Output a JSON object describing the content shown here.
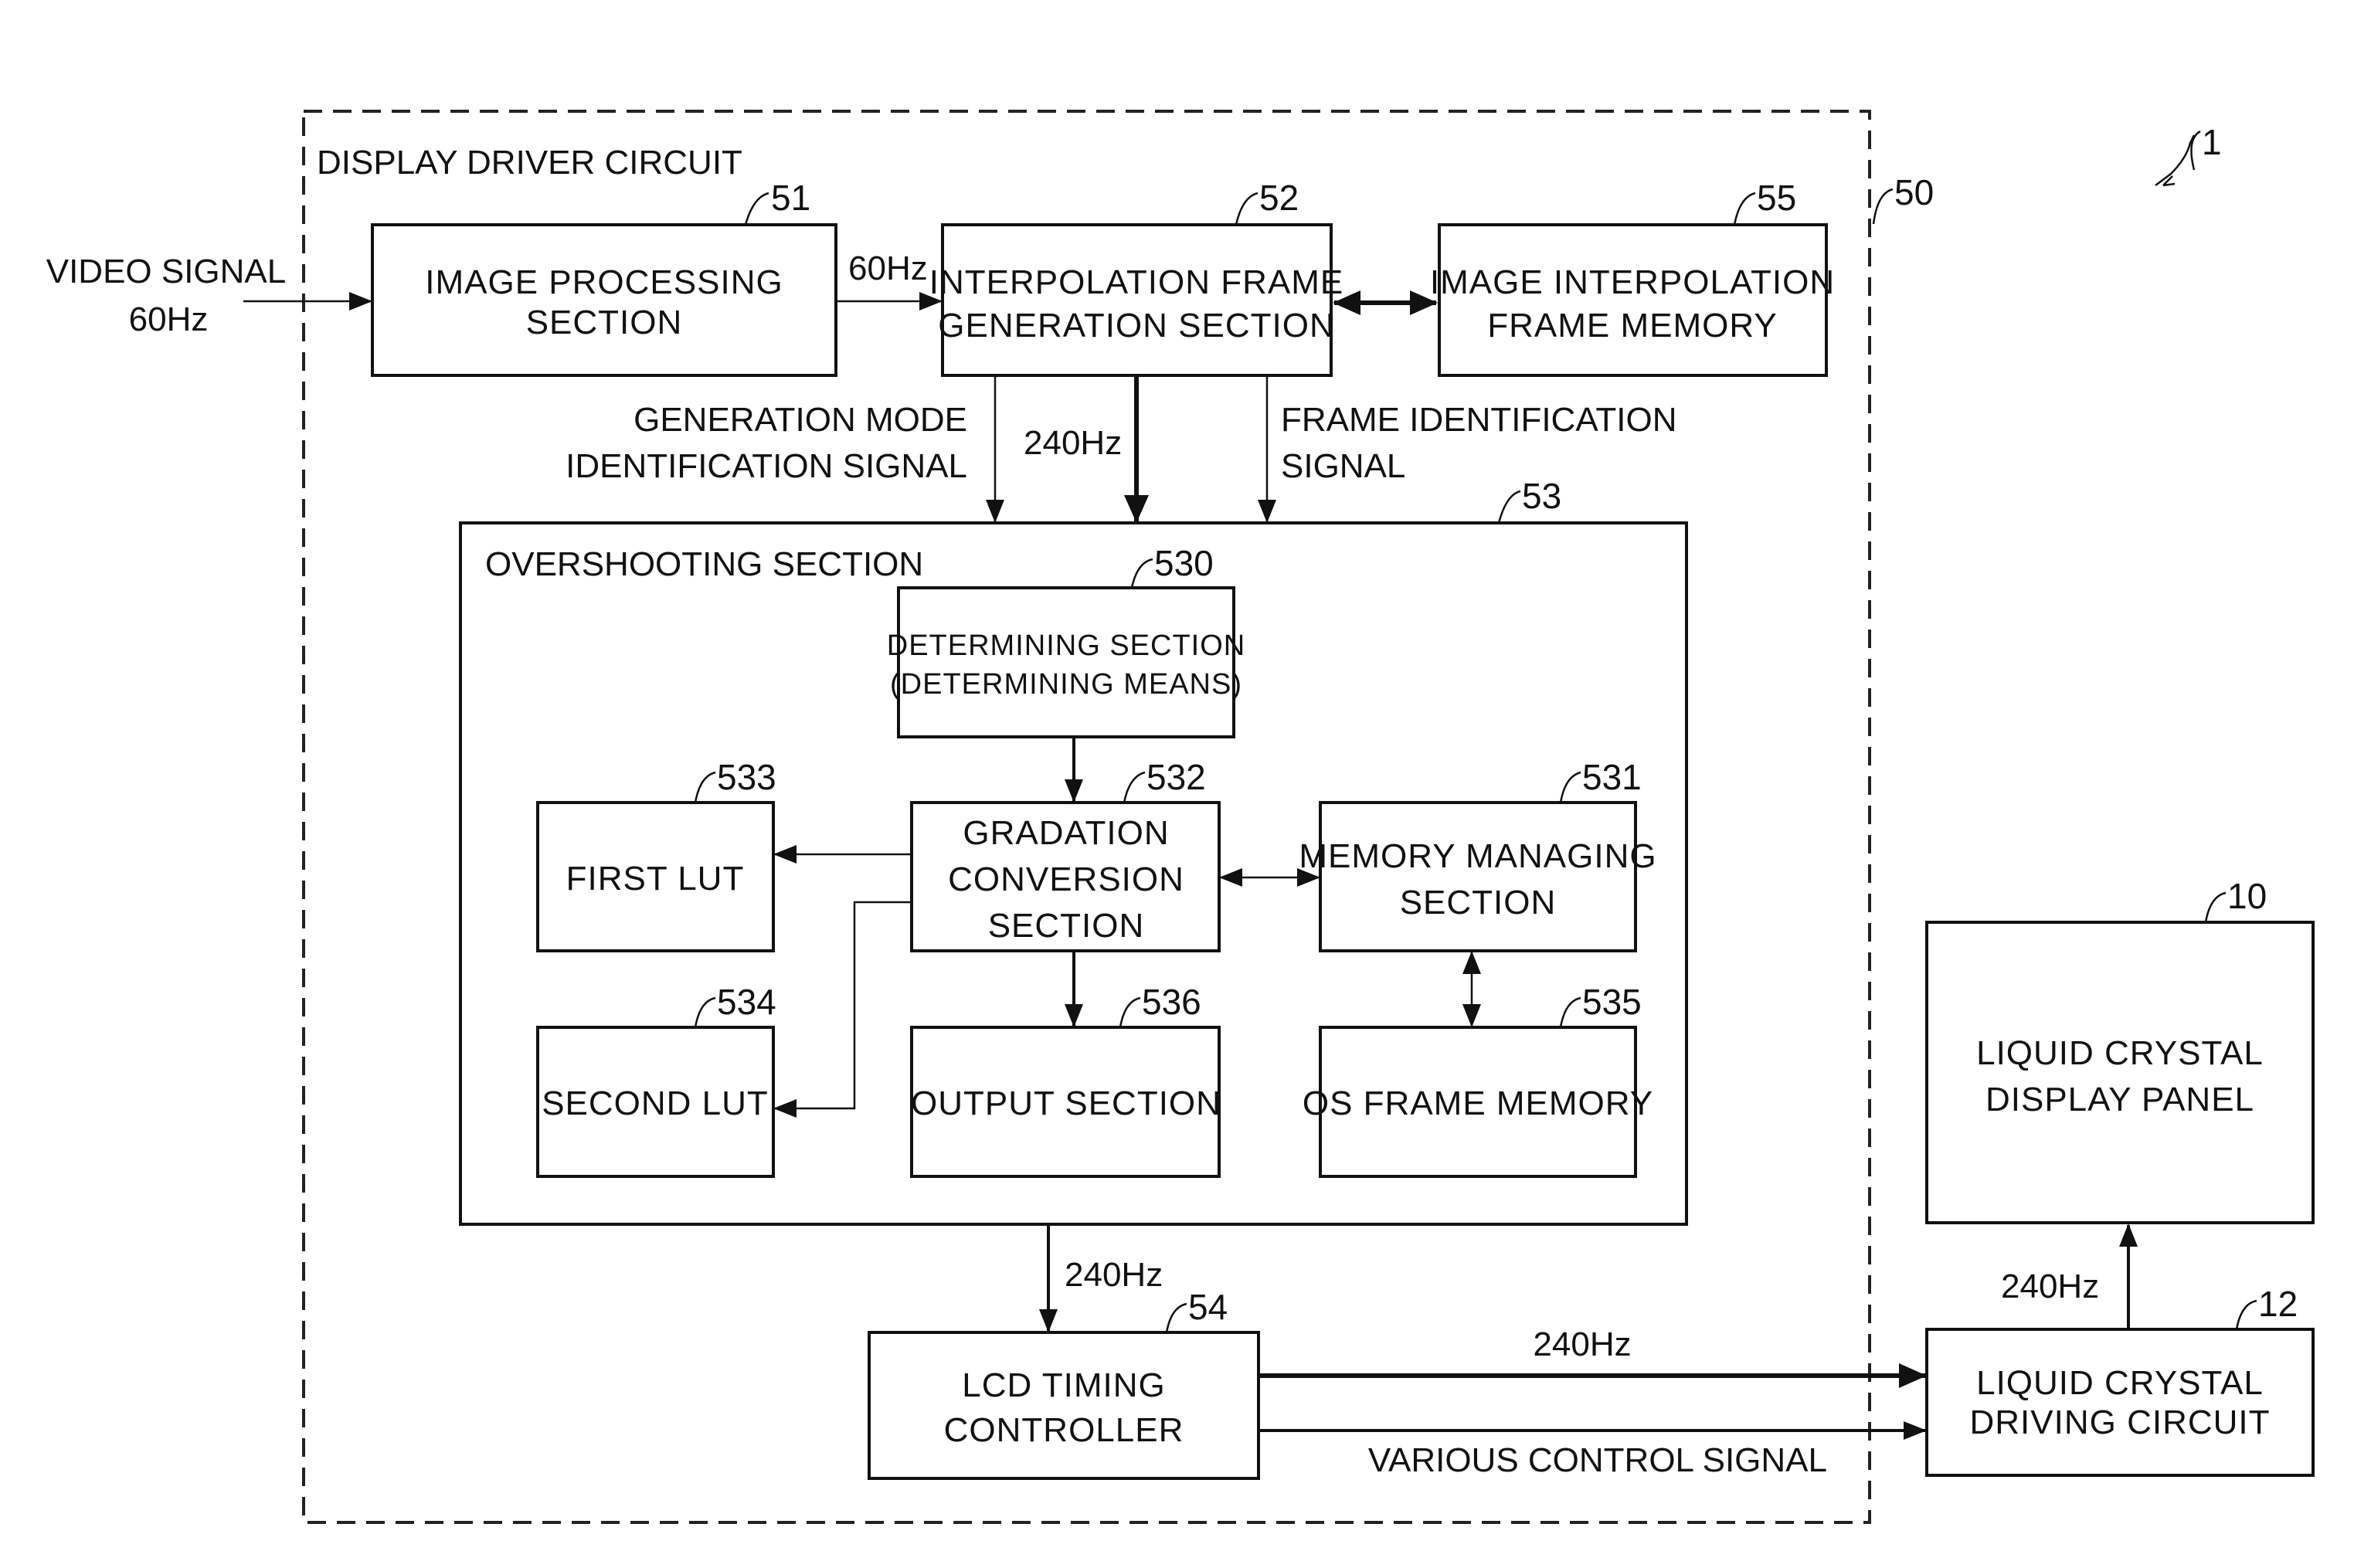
{
  "figure": {
    "reference_number": "1",
    "outer_boundary": {
      "label": "DISPLAY DRIVER CIRCUIT",
      "ref": "50"
    },
    "blocks": {
      "image_processing": {
        "ref": "51",
        "lines": [
          "IMAGE PROCESSING",
          "SECTION"
        ]
      },
      "interpolation_frame_generation": {
        "ref": "52",
        "lines": [
          "INTERPOLATION FRAME",
          "GENERATION SECTION"
        ]
      },
      "image_interpolation_frame_memory": {
        "ref": "55",
        "lines": [
          "IMAGE INTERPOLATION",
          "FRAME MEMORY"
        ]
      },
      "overshooting": {
        "ref": "53",
        "label": "OVERSHOOTING SECTION"
      },
      "determining": {
        "ref": "530",
        "lines": [
          "DETERMINING SECTION",
          "(DETERMINING MEANS)"
        ]
      },
      "gradation_conversion": {
        "ref": "532",
        "lines": [
          "GRADATION",
          "CONVERSION",
          "SECTION"
        ]
      },
      "first_lut": {
        "ref": "533",
        "lines": [
          "FIRST LUT"
        ]
      },
      "second_lut": {
        "ref": "534",
        "lines": [
          "SECOND LUT"
        ]
      },
      "memory_managing": {
        "ref": "531",
        "lines": [
          "MEMORY MANAGING",
          "SECTION"
        ]
      },
      "output": {
        "ref": "536",
        "lines": [
          "OUTPUT SECTION"
        ]
      },
      "os_frame_memory": {
        "ref": "535",
        "lines": [
          "OS FRAME MEMORY"
        ]
      },
      "lcd_timing_controller": {
        "ref": "54",
        "lines": [
          "LCD TIMING",
          "CONTROLLER"
        ]
      },
      "lcd_panel": {
        "ref": "10",
        "lines": [
          "LIQUID CRYSTAL",
          "DISPLAY PANEL"
        ]
      },
      "lcd_driving_circuit": {
        "ref": "12",
        "lines": [
          "LIQUID CRYSTAL",
          "DRIVING CIRCUIT"
        ]
      }
    },
    "signals": {
      "video_in": [
        "VIDEO SIGNAL",
        "60Hz"
      ],
      "ip_to_ifg": "60Hz",
      "gen_mode": [
        "GENERATION MODE",
        "IDENTIFICATION SIGNAL"
      ],
      "ifg_to_os": "240Hz",
      "frame_id": [
        "FRAME IDENTIFICATION",
        "SIGNAL"
      ],
      "os_to_tc": "240Hz",
      "tc_to_drv": "240Hz",
      "control": "VARIOUS CONTROL SIGNAL",
      "drv_to_panel": "240Hz"
    }
  }
}
